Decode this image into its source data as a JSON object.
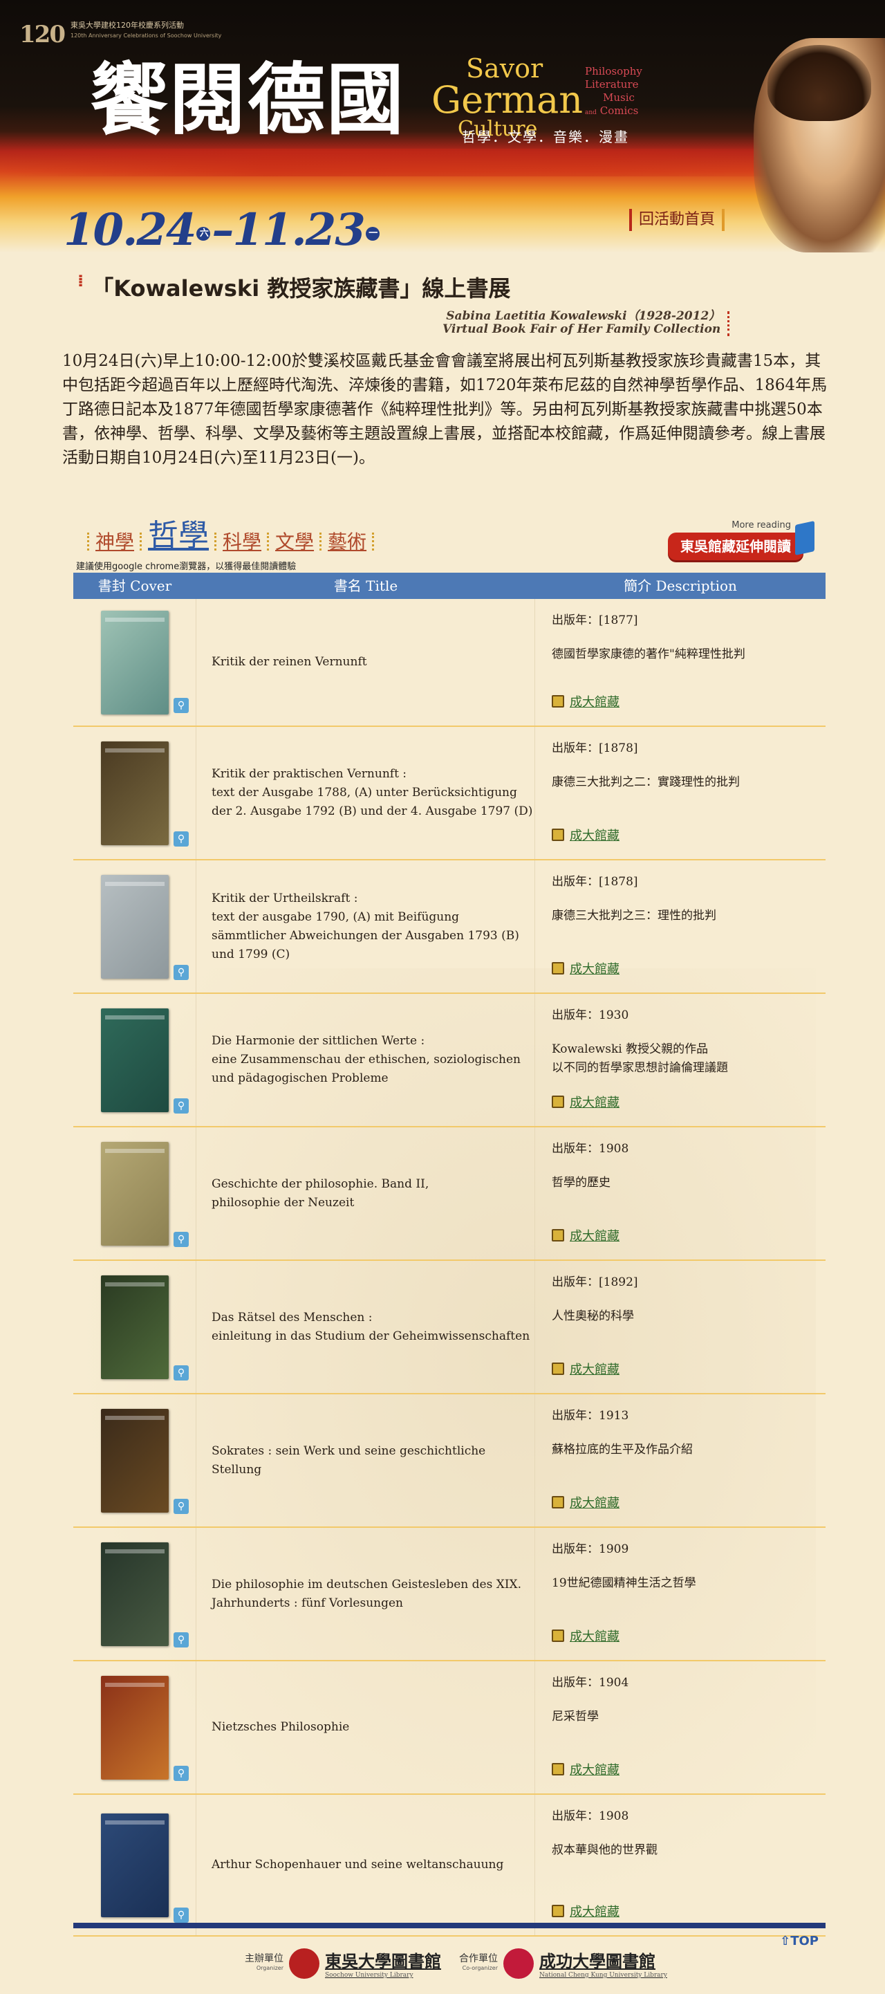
{
  "header": {
    "logo_num": "120",
    "logo_cn": "東吳大學建校120年校慶系列活動",
    "logo_en": "120th Anniversary Celebrations of Soochow University",
    "title_cn": "饗閱德國",
    "savor_1": "Savor",
    "savor_2": "German",
    "savor_3": "Culture",
    "topics": [
      "Philosophy",
      "Literature",
      "Music",
      "and",
      "Comics"
    ],
    "subtitle_cn": "哲學．文學．音樂．漫畫",
    "date_start": "10.24",
    "day_start": "六",
    "date_sep": "–",
    "date_end": "11.23",
    "day_end": "一",
    "home_link": "回活動首頁"
  },
  "exhibit": {
    "title": "「Kowalewski 教授家族藏書」線上書展",
    "sub_1": "Sabina Laetitia Kowalewski（1928-2012）",
    "sub_2": "Virtual Book Fair of Her Family Collection",
    "intro": "10月24日(六)早上10:00-12:00於雙溪校區戴氏基金會會議室將展出柯瓦列斯基教授家族珍貴藏書15本，其中包括距今超過百年以上歷經時代淘洗、淬煉後的書籍，如1720年萊布尼茲的自然神學哲學作品、1864年馬丁路德日記本及1877年德國哲學家康德著作《純粹理性批判》等。另由柯瓦列斯基教授家族藏書中挑選50本書，依神學、哲學、科學、文學及藝術等主題設置線上書展，並搭配本校館藏，作爲延伸閱讀參考。線上書展活動日期自10月24日(六)至11月23日(一)。"
  },
  "categories": [
    "神學",
    "哲學",
    "科學",
    "文學",
    "藝術"
  ],
  "more_reading": {
    "small": "More reading",
    "label": "東吳館藏延伸閱讀"
  },
  "browser_note": "建議使用google chrome瀏覽器，以獲得最佳閱讀體驗",
  "table": {
    "headers": [
      "書封 Cover",
      "書名 Title",
      "簡介 Description"
    ],
    "link_label": "成大館藏",
    "zoom_icon": "magnifier-icon",
    "rows": [
      {
        "title": "Kritik der reinen Vernunft",
        "year": "出版年：[1877]",
        "desc": "德國哲學家康德的著作\"純粹理性批判",
        "color": "#9fc3b5",
        "color2": "#5f8e86"
      },
      {
        "title": "Kritik der praktischen Vernunft :\ntext der Ausgabe 1788, (A) unter Berücksichtigung der 2. Ausgabe 1792 (B) und der 4. Ausgabe 1797 (D)",
        "year": "出版年：[1878]",
        "desc": "康德三大批判之二：實踐理性的批判",
        "color": "#4a3a22",
        "color2": "#7a6a40"
      },
      {
        "title": "Kritik der Urtheilskraft :\ntext der ausgabe 1790, (A) mit Beifügung sämmtlicher Abweichungen der Ausgaben 1793 (B) und 1799 (C)",
        "year": "出版年：[1878]",
        "desc": "康德三大批判之三：理性的批判",
        "color": "#b7bfc2",
        "color2": "#8e989c"
      },
      {
        "title": "Die Harmonie der sittlichen Werte :\neine Zusammenschau der ethischen, soziologischen und pädagogischen Probleme",
        "year": "出版年：1930",
        "desc": "Kowalewski 教授父親的作品\n以不同的哲學家思想討論倫理議題",
        "color": "#2f6a5a",
        "color2": "#1e4a40"
      },
      {
        "title": "Geschichte der philosophie. Band II,\nphilosophie der Neuzeit",
        "year": "出版年：1908",
        "desc": "哲學的歷史",
        "color": "#b5a874",
        "color2": "#8d8152"
      },
      {
        "title": "Das Rätsel des Menschen :\neinleitung in das Studium der Geheimwissenschaften",
        "year": "出版年：[1892]",
        "desc": "人性奧秘的科學",
        "color": "#2a3a22",
        "color2": "#4f6a3a"
      },
      {
        "title": "Sokrates : sein Werk und seine geschichtliche Stellung",
        "year": "出版年：1913",
        "desc": "蘇格拉底的生平及作品介紹",
        "color": "#3a2a1a",
        "color2": "#6a4a22"
      },
      {
        "title": "Die philosophie im deutschen Geistesleben des XIX. Jahrhunderts : fünf Vorlesungen",
        "year": "出版年：1909",
        "desc": "19世紀德國精神生活之哲學",
        "color": "#26352a",
        "color2": "#485a42"
      },
      {
        "title": "Nietzsches Philosophie",
        "year": "出版年：1904",
        "desc": "尼采哲學",
        "color": "#8a3018",
        "color2": "#c8752a"
      },
      {
        "title": "Arthur Schopenhauer und seine weltanschauung",
        "year": "出版年：1908",
        "desc": "叔本華與他的世界觀",
        "color": "#2d4a78",
        "color2": "#1a3055"
      }
    ]
  },
  "footer": {
    "organizer_label": "主辦單位",
    "organizer_en": "Organizer",
    "organizer_name": "東吳大學圖書館",
    "organizer_name_en": "Soochow University Library",
    "coorganizer_label": "合作單位",
    "coorganizer_en": "Co-organizer",
    "coorganizer_name": "成功大學圖書館",
    "coorganizer_name_en": "National Cheng Kung University Library",
    "top_link": "⇧TOP"
  }
}
